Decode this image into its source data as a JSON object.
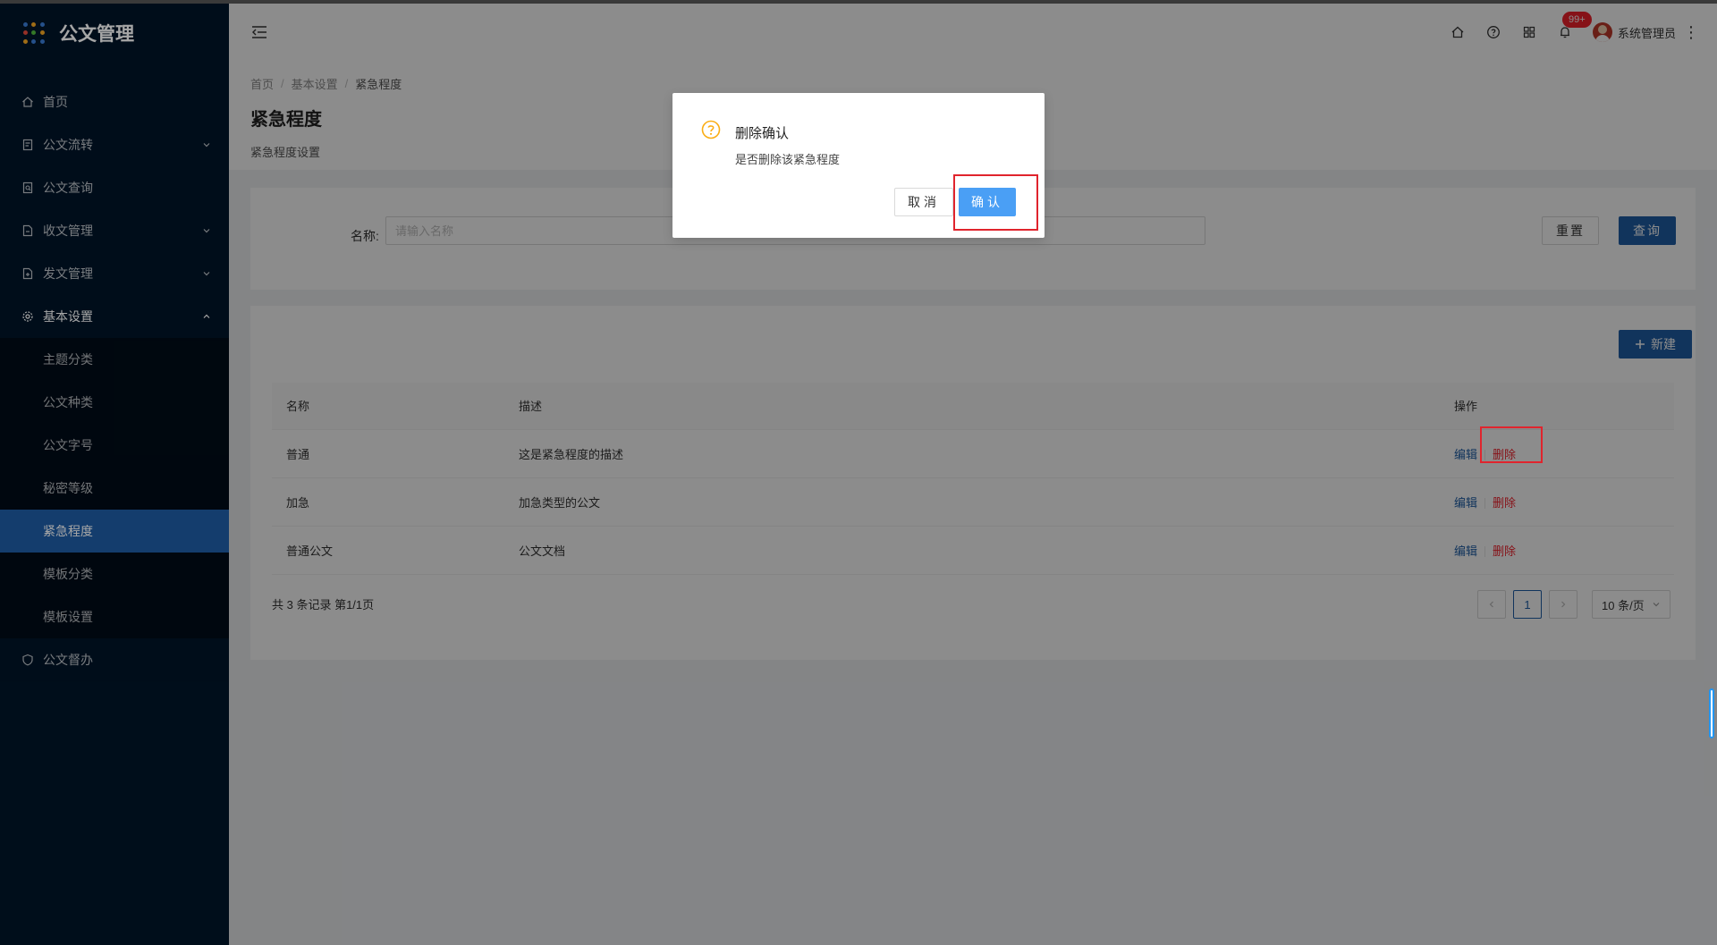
{
  "app": {
    "title": "公文管理"
  },
  "sidebar": {
    "items": [
      {
        "label": "首页",
        "icon": "home-icon"
      },
      {
        "label": "公文流转",
        "icon": "file-icon"
      },
      {
        "label": "公文查询",
        "icon": "file-search-icon"
      },
      {
        "label": "收文管理",
        "icon": "file-in-icon"
      },
      {
        "label": "发文管理",
        "icon": "file-out-icon"
      },
      {
        "label": "基本设置",
        "icon": "gear-icon"
      },
      {
        "label": "公文督办",
        "icon": "shield-icon"
      }
    ],
    "submenu": [
      {
        "label": "主题分类"
      },
      {
        "label": "公文种类"
      },
      {
        "label": "公文字号"
      },
      {
        "label": "秘密等级"
      },
      {
        "label": "紧急程度"
      },
      {
        "label": "模板分类"
      },
      {
        "label": "模板设置"
      }
    ]
  },
  "header": {
    "badge": "99+",
    "user": "系统管理员"
  },
  "page": {
    "breadcrumb": [
      "首页",
      "基本设置",
      "紧急程度"
    ],
    "title": "紧急程度",
    "desc": "紧急程度设置"
  },
  "search": {
    "label": "名称:",
    "placeholder": "请输入名称",
    "reset": "重置",
    "query": "查询"
  },
  "table": {
    "new_button": "新建",
    "columns": [
      "名称",
      "描述",
      "操作"
    ],
    "rows": [
      {
        "name": "普通",
        "desc": "这是紧急程度的描述"
      },
      {
        "name": "加急",
        "desc": "加急类型的公文"
      },
      {
        "name": "普通公文",
        "desc": "公文文档"
      }
    ],
    "edit": "编辑",
    "delete": "删除",
    "total": "共 3 条记录 第1/1页",
    "page": "1",
    "page_size": "10 条/页"
  },
  "modal": {
    "title": "删除确认",
    "content": "是否删除该紧急程度",
    "cancel": "取消",
    "confirm": "确认"
  },
  "colors": {
    "sidebar_bg": "#001529",
    "primary": "#1f5fa8",
    "danger": "#f5222d",
    "confirm": "#4a9ff5",
    "warning_icon": "#faad14",
    "highlight": "#e0242d"
  }
}
